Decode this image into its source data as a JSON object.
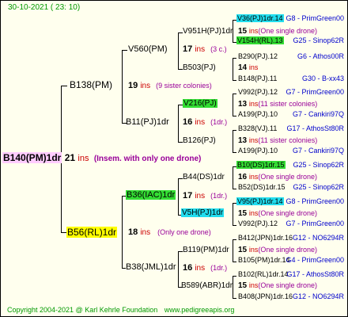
{
  "header": {
    "date": "30-10-2021 ( 23: 10)"
  },
  "footer": {
    "copyright": "Copyright 2004-2021 @ Karl Kehrle Foundation",
    "site": "www.pedigreeapis.org"
  },
  "colors": {
    "green_highlight": "#33dd33",
    "cyan_highlight": "#22ddee",
    "yellow_highlight": "#ffff00",
    "pink_highlight": "#ffccff",
    "ins": "#cc0000",
    "note": "#990099",
    "line_info": "#0000cc",
    "footer": "#009900"
  },
  "root": {
    "label": "B140(PM)1dr",
    "ins_value": "21",
    "ins_word": "ins",
    "note": "(Insem. with only one drone)"
  },
  "gen1": [
    {
      "label": "B138(PM)",
      "ins_value": "19",
      "ins_word": "ins",
      "note": "(9 sister colonies)"
    },
    {
      "label": "B56(RL)1dr",
      "ins_value": "18",
      "ins_word": "ins",
      "note": "(Only one drone)"
    }
  ],
  "gen2": [
    {
      "label": "V560(PM)",
      "ins_value": "17",
      "ins_word": "ins",
      "note": "(3 c.)"
    },
    {
      "label": "B11(PJ)1dr",
      "ins_value": "16",
      "ins_word": "ins",
      "note": "(1dr.)"
    },
    {
      "label": "B36(IAC)1dr",
      "ins_value": "17",
      "ins_word": "ins",
      "note": "(1dr.)"
    },
    {
      "label": "B38(JML)1dr",
      "ins_value": "16",
      "ins_word": "ins",
      "note": "(1dr.)"
    }
  ],
  "gen3": [
    {
      "label": "V951H(PJ)1dr",
      "ins_value": "15",
      "ins_word": "ins",
      "note": "(One single drone)"
    },
    {
      "label": "B503(PJ)",
      "ins_value": "14",
      "ins_word": "ins",
      "note": ""
    },
    {
      "label": "V216(PJ)",
      "ins_value": "13",
      "ins_word": "ins",
      "note": "(11 sister colonies)"
    },
    {
      "label": "B126(PJ)",
      "ins_value": "13",
      "ins_word": "ins",
      "note": "(11 sister colonies)"
    },
    {
      "label": "B44(DS)1dr",
      "ins_value": "16",
      "ins_word": "ins",
      "note": "(One single drone)"
    },
    {
      "label": "V5H(PJ)1dr",
      "ins_value": "15",
      "ins_word": "ins",
      "note": "(One single drone)"
    },
    {
      "label": "B119(PM)1dr",
      "ins_value": "15",
      "ins_word": "ins",
      "note": "(One single drone)"
    },
    {
      "label": "B589(ABR)1dr",
      "ins_value": "15",
      "ins_word": "ins",
      "note": "(One single drone)"
    }
  ],
  "gen4": [
    {
      "label": "V36(PJ)1dr.14",
      "info": "G8 - PrimGreen00"
    },
    {
      "label": "V154H(RL).13",
      "info": "G25 - Sinop62R"
    },
    {
      "label": "B290(PJ).12",
      "info": "G6 - Athos00R"
    },
    {
      "label": "B148(PJ).11",
      "info": "G30 - B-xx43"
    },
    {
      "label": "V992(PJ).12",
      "info": "G7 - PrimGreen00"
    },
    {
      "label": "A199(PJ).10",
      "info": "G7 - Cankiri97Q"
    },
    {
      "label": "B328(VJ).11",
      "info": "G17 - AthosSt80R"
    },
    {
      "label": "A199(PJ).10",
      "info": "G7 - Cankiri97Q"
    },
    {
      "label": "B10(DS)1dr.15",
      "info": "G25 - Sinop62R"
    },
    {
      "label": "B52(DS)1dr.15",
      "info": "G25 - Sinop62R"
    },
    {
      "label": "V95(PJ)1dr.14",
      "info": "G8 - PrimGreen00"
    },
    {
      "label": "V992(PJ).12",
      "info": "G7 - PrimGreen00"
    },
    {
      "label": "B412(JPN)1dr.16",
      "info": "G12 - NO6294R"
    },
    {
      "label": "B105(PM)1dr.14",
      "info": "G4 - PrimGreen00"
    },
    {
      "label": "B102(RL)1dr.14",
      "info": "G17 - AthosSt80R"
    },
    {
      "label": "B408(JPN)1dr.16",
      "info": "G12 - NO6294R"
    }
  ]
}
